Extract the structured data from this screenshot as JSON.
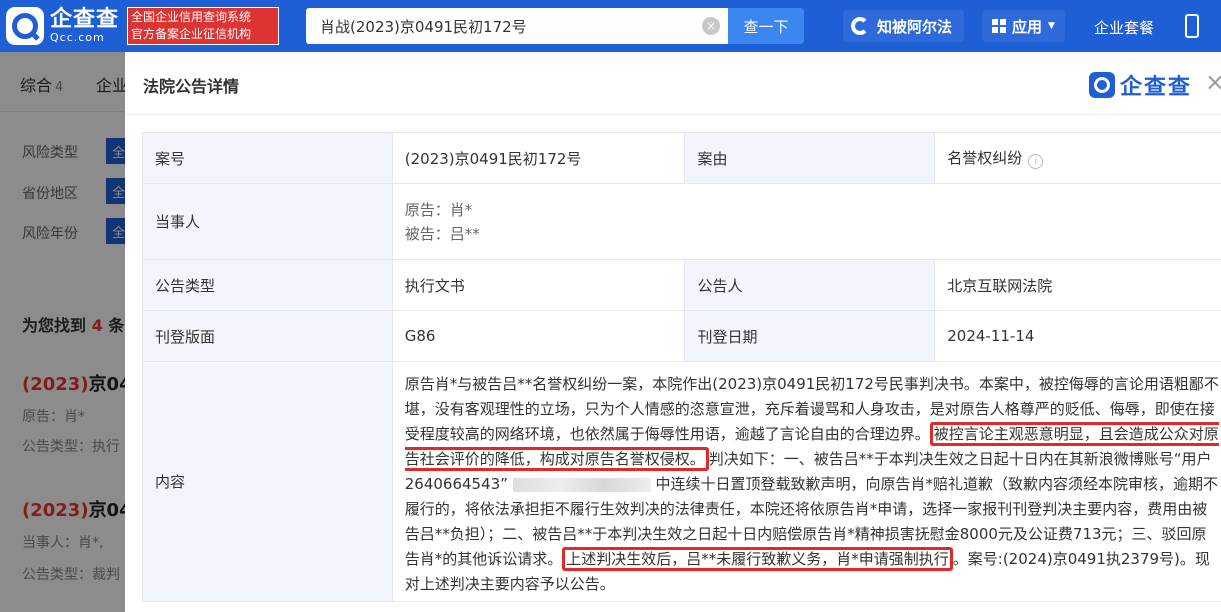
{
  "header": {
    "logo_cn": "企查查",
    "logo_en": "Qcc.com",
    "slogan_line1": "全国企业信用查询系统",
    "slogan_line2": "官方备案企业征信机构",
    "search_value": "肖战(2023)京0491民初172号",
    "clear_icon": "×",
    "search_button": "查一下",
    "alpha_label": "知被阿尔法",
    "apps_label": "应用",
    "package_label": "企业套餐"
  },
  "background": {
    "tabs": [
      {
        "label": "综合",
        "count": "4"
      },
      {
        "label": "企业",
        "count": ""
      }
    ],
    "filters": [
      "风险类型",
      "省份地区",
      "风险年份"
    ],
    "filter_btn": "全",
    "found_prefix": "为您找到",
    "found_count": "4",
    "found_suffix": "条",
    "case1_title_red": "(2023)",
    "case1_title": "京04",
    "case1_line1": "原告：肖*",
    "case1_line2": "公告类型：执行",
    "case2_title_red": "(2023)",
    "case2_title": "京04",
    "case2_line1": "当事人：肖*,",
    "case2_line2": "公告类型：裁判"
  },
  "modal": {
    "title": "法院公告详情",
    "brand": "企查查",
    "close": "×",
    "rows": {
      "case_no_label": "案号",
      "case_no_value": "(2023)京0491民初172号",
      "cause_label": "案由",
      "cause_value": "名誉权纠纷",
      "party_label": "当事人",
      "plaintiff": "原告：肖*",
      "defendant": "被告：吕**",
      "type_label": "公告类型",
      "type_value": "执行文书",
      "announcer_label": "公告人",
      "announcer_value": "北京互联网法院",
      "page_label": "刊登版面",
      "page_value": "G86",
      "date_label": "刊登日期",
      "date_value": "2024-11-14",
      "content_label": "内容"
    },
    "content": {
      "p1": "原告肖*与被告吕**名誉权纠纷一案，本院作出(2023)京0491民初172号民事判决书。本案中，被控侮辱的言论用语粗鄙不堪，没有客观理性的立场，只为个人情感的恣意宣泄，充斥着谩骂和人身攻击，是对原告人格尊严的贬低、侮辱，即使在接受程度较高的网络环境，也依然属于侮辱性用语，逾越了言论自由的合理边界。",
      "h1": "被控言论主观恶意明显，且会造成公众对原告社会评价的降低，构成对原告名誉权侵权。",
      "p2": "判决如下：一、被告吕**于本判决生效之日起十日内在其新浪微博账号“用户2640664543”",
      "p3": "中连续十日置顶登载致歉声明，向原告肖*赔礼道歉（致歉内容须经本院审核，逾期不履行的，将依法承担拒不履行生效判决的法律责任，本院还将依原告肖*申请，选择一家报刊刊登判决主要内容，费用由被告吕**负担）；二、被告吕**于本判决生效之日起十日内赔偿原告肖*精神损害抚慰金8000元及公证费713元；三、驳回原告肖*的其他诉讼请求。",
      "h2": "上述判决生效后，吕**未履行致歉义务，肖*申请强制执行",
      "p4": "。案号:(2024)京0491执2379号)。现对上述判决主要内容予以公告。"
    }
  }
}
